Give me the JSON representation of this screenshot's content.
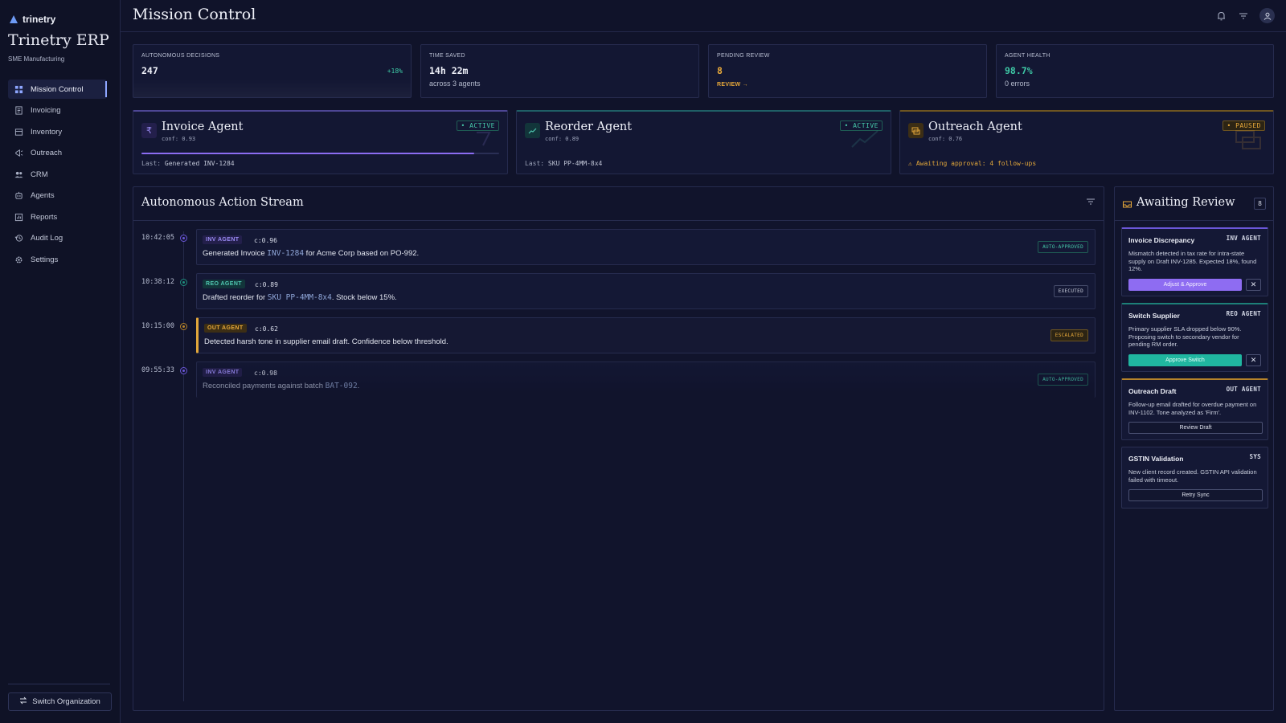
{
  "brand": {
    "name": "trinetry",
    "app_title": "Trinetry ERP",
    "subtitle": "SME Manufacturing"
  },
  "nav": [
    {
      "label": "Mission Control",
      "icon": "grid-icon",
      "active": true
    },
    {
      "label": "Invoicing",
      "icon": "document-icon"
    },
    {
      "label": "Inventory",
      "icon": "box-icon"
    },
    {
      "label": "Outreach",
      "icon": "megaphone-icon"
    },
    {
      "label": "CRM",
      "icon": "users-icon"
    },
    {
      "label": "Agents",
      "icon": "robot-icon"
    },
    {
      "label": "Reports",
      "icon": "report-icon"
    },
    {
      "label": "Audit Log",
      "icon": "history-icon"
    },
    {
      "label": "Settings",
      "icon": "gear-icon"
    }
  ],
  "switch_org": "Switch Organization",
  "header": {
    "title": "Mission Control"
  },
  "stats": {
    "decisions": {
      "label": "AUTONOMOUS DECISIONS",
      "value": "247",
      "delta": "+18%"
    },
    "time_saved": {
      "label": "TIME SAVED",
      "value": "14h 22m",
      "sub": "across 3 agents"
    },
    "pending": {
      "label": "PENDING REVIEW",
      "value": "8",
      "link": "REVIEW"
    },
    "health": {
      "label": "AGENT HEALTH",
      "value": "98.7%",
      "sub": "0 errors"
    }
  },
  "agents": {
    "invoice": {
      "name": "Invoice Agent",
      "conf": "conf: 0.93",
      "status": "ACTIVE",
      "last_label": "Last:",
      "last_value": "Generated INV-1284",
      "progress": 0.93
    },
    "reorder": {
      "name": "Reorder Agent",
      "conf": "conf: 0.89",
      "status": "ACTIVE",
      "last_label": "Last:",
      "last_value": "SKU PP-4MM-8x4"
    },
    "outreach": {
      "name": "Outreach Agent",
      "conf": "conf: 0.76",
      "status": "PAUSED",
      "warning": "Awaiting approval: 4 follow-ups"
    }
  },
  "stream": {
    "title": "Autonomous Action Stream",
    "events": [
      {
        "time": "10:42:05",
        "tag": "INV AGENT",
        "conf": "c:0.96",
        "msg_pre": "Generated Invoice ",
        "msg_code": "INV-1284",
        "msg_post": " for Acme Corp based on PO-992.",
        "status": "AUTO-APPROVED"
      },
      {
        "time": "10:38:12",
        "tag": "REO AGENT",
        "conf": "c:0.89",
        "msg_pre": "Drafted reorder for ",
        "msg_code": "SKU PP-4MM-8x4",
        "msg_post": ". Stock below 15%.",
        "status": "EXECUTED"
      },
      {
        "time": "10:15:00",
        "tag": "OUT AGENT",
        "conf": "c:0.62",
        "msg_pre": "Detected harsh tone in supplier email draft. Confidence below threshold.",
        "msg_code": "",
        "msg_post": "",
        "status": "ESCALATED"
      },
      {
        "time": "09:55:33",
        "tag": "INV AGENT",
        "conf": "c:0.98",
        "msg_pre": "Reconciled payments against batch ",
        "msg_code": "BAT-092",
        "msg_post": ".",
        "status": "AUTO-APPROVED"
      }
    ]
  },
  "review": {
    "title": "Awaiting Review",
    "count": "8",
    "cards": [
      {
        "title": "Invoice Discrepancy",
        "tag": "INV AGENT",
        "desc": "Mismatch detected in tax rate for intra-state supply on Draft INV-1285. Expected 18%, found 12%.",
        "button": "Adjust & Approve"
      },
      {
        "title": "Switch Supplier",
        "tag": "REO AGENT",
        "desc": "Primary supplier SLA dropped below 90%. Proposing switch to secondary vendor for pending RM order.",
        "button": "Approve Switch"
      },
      {
        "title": "Outreach Draft",
        "tag": "OUT AGENT",
        "desc": "Follow-up email drafted for overdue payment on INV-1102. Tone analyzed as 'Firm'.",
        "button": "Review Draft"
      },
      {
        "title": "GSTIN Validation",
        "tag": "SYS",
        "desc": "New client record created. GSTIN API validation failed with timeout.",
        "button": "Retry Sync"
      }
    ]
  },
  "colors": {
    "accent_purple": "#8e6cf2",
    "accent_teal": "#20b6a0",
    "accent_amber": "#e8a93a",
    "background": "#10132a"
  }
}
